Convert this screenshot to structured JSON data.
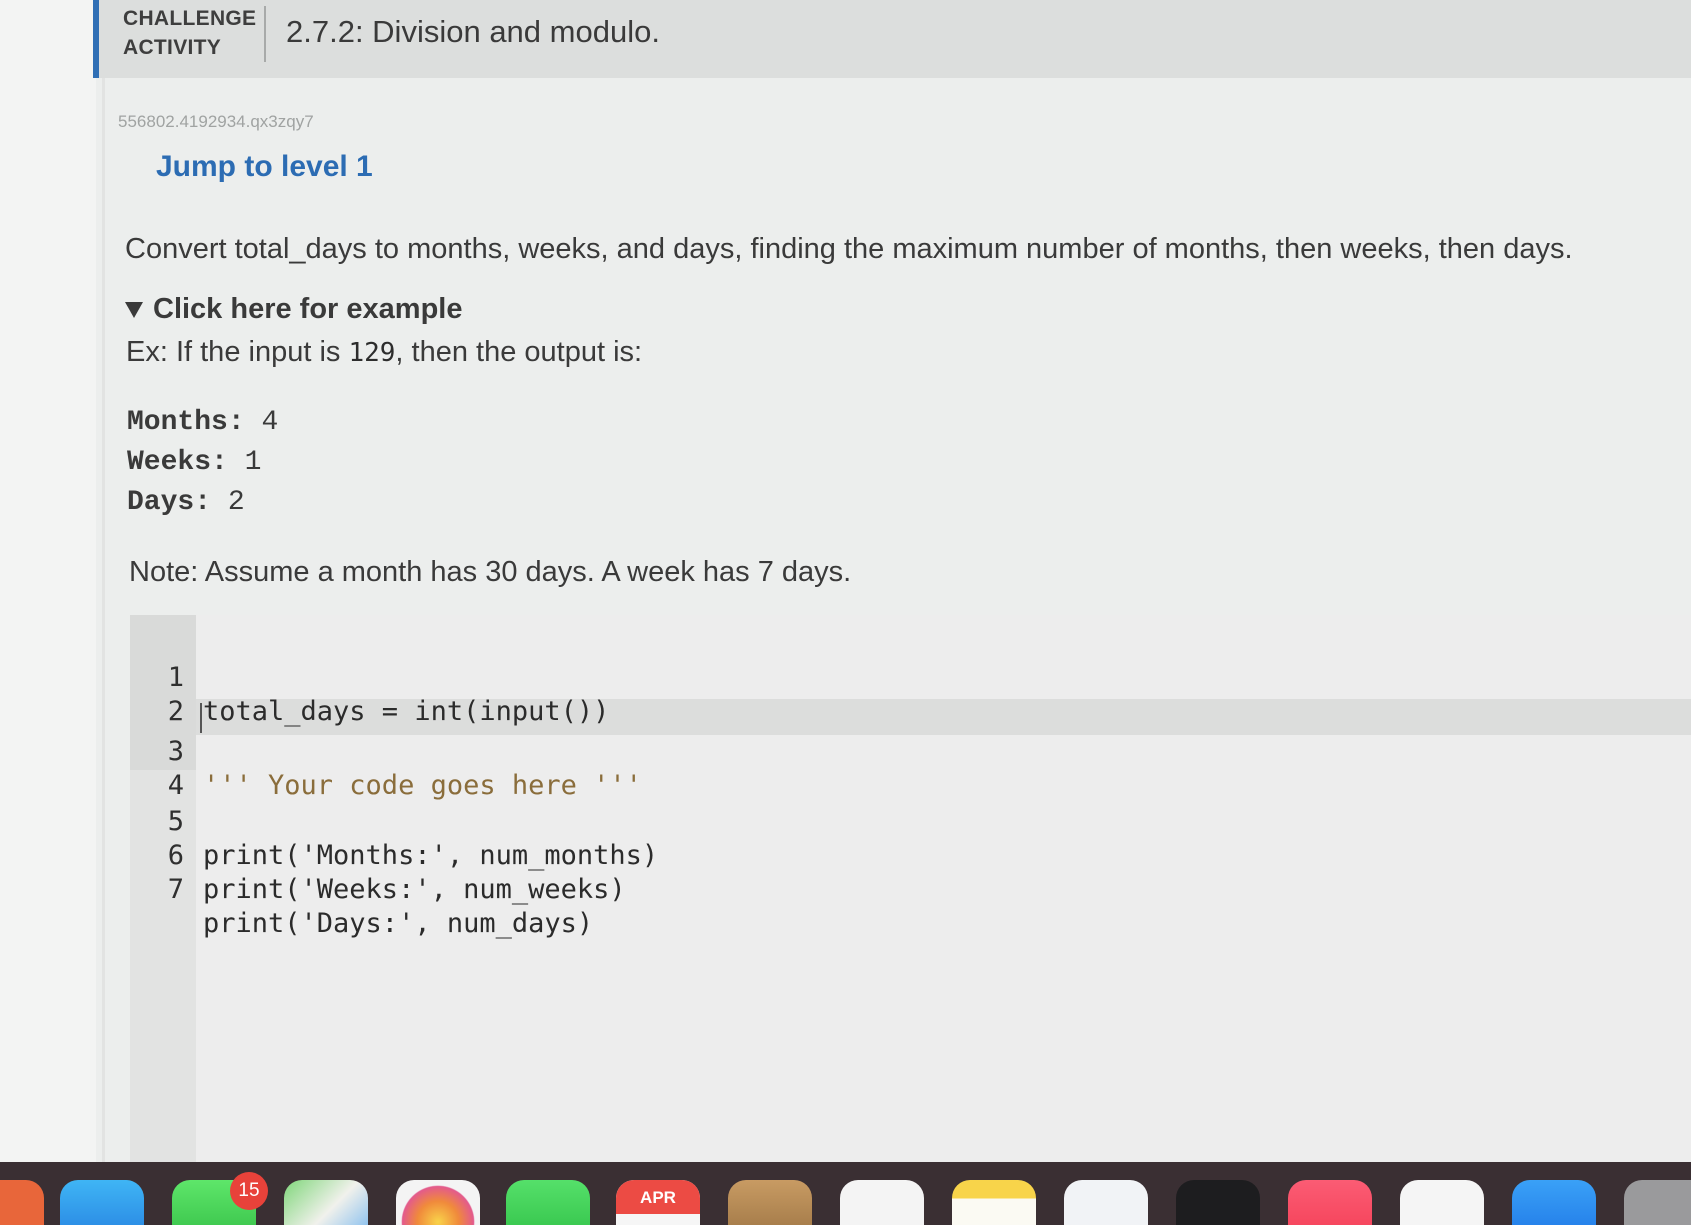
{
  "header": {
    "label_line1": "CHALLENGE",
    "label_line2": "ACTIVITY",
    "title": "2.7.2: Division and modulo."
  },
  "activity_id": "556802.4192934.qx3zqy7",
  "jump_link": "Jump to level 1",
  "instructions": "Convert total_days to months, weeks, and days, finding the maximum number of months, then weeks, then days.",
  "example": {
    "toggle_label": "Click here for example",
    "intro_before": "Ex: If the input is ",
    "input_value": "129",
    "intro_after": ", then the output is:",
    "output": [
      {
        "label": "Months:",
        "value": "4"
      },
      {
        "label": "Weeks:",
        "value": "1"
      },
      {
        "label": "Days:",
        "value": "2"
      }
    ]
  },
  "note": "Note: Assume a month has 30 days. A week has 7 days.",
  "code_lines": [
    {
      "num": "1",
      "text": "total_days = int(input())"
    },
    {
      "num": "2",
      "text": ""
    },
    {
      "num": "3",
      "text": "''' Your code goes here '''"
    },
    {
      "num": "4",
      "text": ""
    },
    {
      "num": "5",
      "text": "print('Months:', num_months)"
    },
    {
      "num": "6",
      "text": "print('Weeks:', num_weeks)"
    },
    {
      "num": "7",
      "text": "print('Days:', num_days)"
    }
  ],
  "dock": {
    "messages_badge": "15",
    "calendar_month": "APR",
    "apps": [
      "safari-icon",
      "messages-icon",
      "maps-icon",
      "photos-icon",
      "facetime-icon",
      "calendar-icon",
      "podcasts-icon",
      "reminders-icon",
      "notes-icon",
      "freeform-icon",
      "appletv-icon",
      "music-icon",
      "news-icon",
      "xcode-icon",
      "settings-icon"
    ]
  },
  "colors": {
    "accent": "#2c6cb3",
    "header_bg": "#dcdedd",
    "editor_bg": "#ededed",
    "dock_bg": "#3a2f33"
  }
}
